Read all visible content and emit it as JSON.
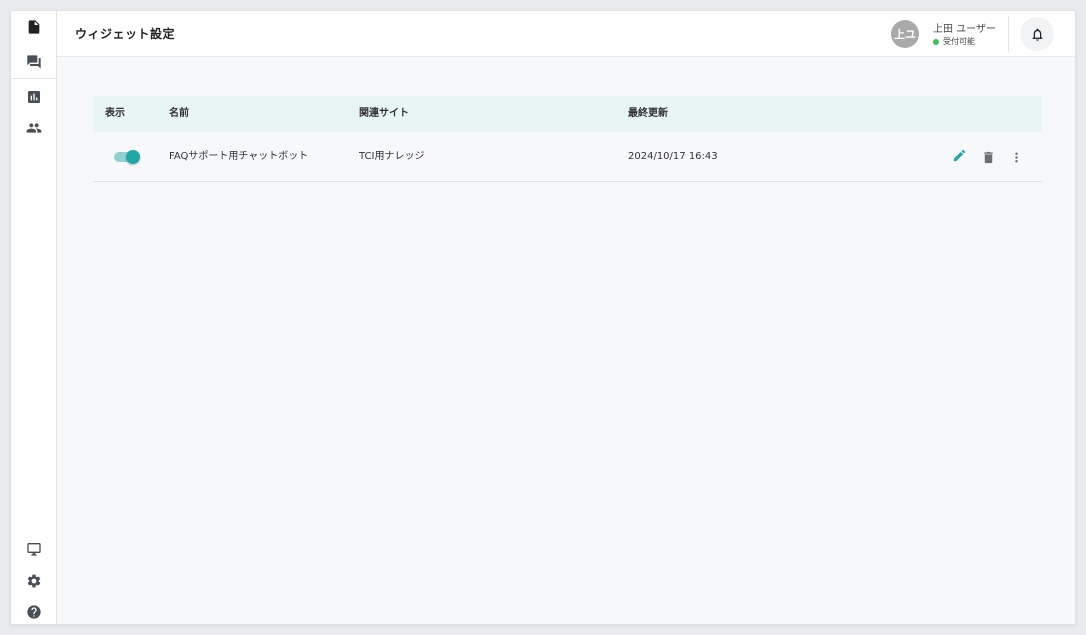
{
  "header": {
    "title": "ウィジェット設定",
    "user": {
      "avatar_text": "上ユ",
      "name": "上田 ユーザー",
      "status": "受付可能"
    }
  },
  "sidebar": {
    "top_icons": [
      "document-icon",
      "chat-icon",
      "chart-icon",
      "users-icon"
    ],
    "bottom_icons": [
      "monitor-icon",
      "gear-icon",
      "help-icon"
    ]
  },
  "table": {
    "columns": {
      "display": "表示",
      "name": "名前",
      "site": "関連サイト",
      "updated": "最終更新"
    },
    "rows": [
      {
        "enabled": true,
        "name": "FAQサポート用チャットボット",
        "site": "TCI用ナレッジ",
        "updated": "2024/10/17 16:43"
      }
    ]
  },
  "colors": {
    "accent": "#21a8a6",
    "header_row_bg": "#e8f5f5",
    "status_online": "#3cc45a"
  }
}
